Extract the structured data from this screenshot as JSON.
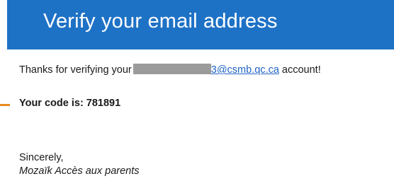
{
  "header": {
    "title": "Verify your email address"
  },
  "message": {
    "thanks_prefix": "Thanks for verifying your",
    "email_visible": "3@csmb.qc.ca",
    "thanks_suffix": " account!",
    "code_line": "Your code is: 781891",
    "closing": "Sincerely,",
    "signature": "Mozaïk Accès aux parents"
  },
  "colors": {
    "banner": "#1e72c6",
    "link": "#1f63c6",
    "accent": "#e98b1f",
    "redaction": "#9b9b9b"
  }
}
